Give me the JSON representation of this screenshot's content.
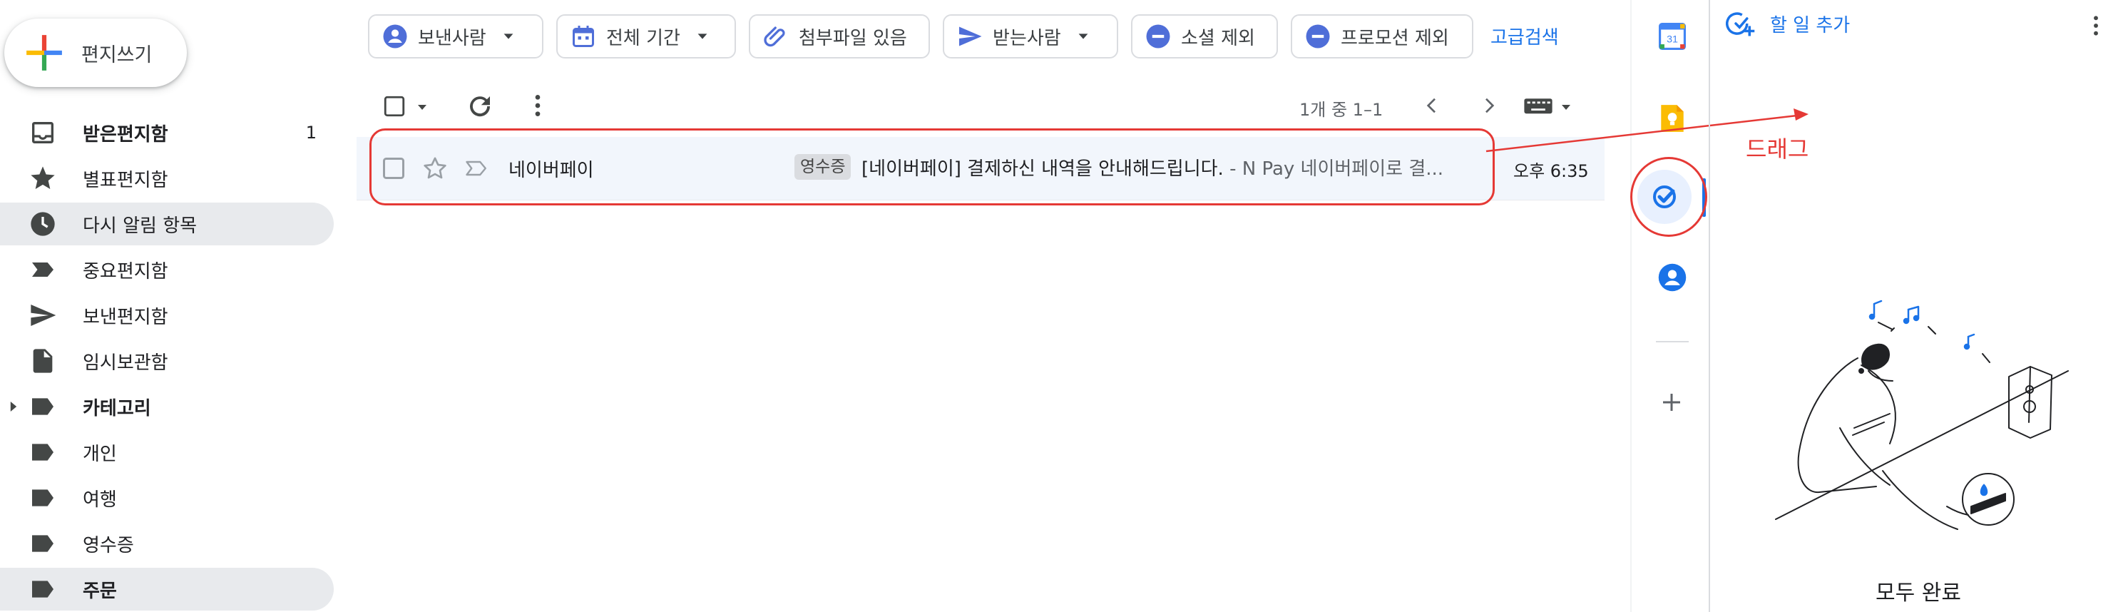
{
  "compose": {
    "label": "편지쓰기"
  },
  "sidebar": {
    "items": [
      {
        "label": "받은편지함",
        "count": "1",
        "icon": "inbox-icon"
      },
      {
        "label": "별표편지함",
        "icon": "star-icon"
      },
      {
        "label": "다시 알림 항목",
        "icon": "clock-icon"
      },
      {
        "label": "중요편지함",
        "icon": "important-icon"
      },
      {
        "label": "보낸편지함",
        "icon": "send-icon"
      },
      {
        "label": "임시보관함",
        "icon": "draft-icon"
      },
      {
        "label": "카테고리",
        "icon": "label-icon"
      },
      {
        "label": "개인",
        "icon": "label-icon"
      },
      {
        "label": "여행",
        "icon": "label-icon"
      },
      {
        "label": "영수증",
        "icon": "label-icon"
      },
      {
        "label": "주문",
        "icon": "label-icon"
      }
    ]
  },
  "search_chips": {
    "sender": "보낸사람",
    "date": "전체 기간",
    "attachment": "첨부파일 있음",
    "recipient": "받는사람",
    "exclude_social": "소셜 제외",
    "exclude_promotions": "프로모션 제외",
    "advanced": "고급검색"
  },
  "toolbar": {
    "pagination": "1개 중 1–1"
  },
  "mail": {
    "sender": "네이버페이",
    "label": "영수증",
    "subject": "[네이버페이] 결제하신 내역을 안내해드립니다.",
    "snippet": " - N Pay 네이버페이로 결...",
    "time": "오후 6:35"
  },
  "rail": {
    "calendar_day": "31"
  },
  "annotation": {
    "drag_label": "드래그",
    "color": "#e53935"
  },
  "tasks": {
    "add_task": "할 일 추가",
    "empty_state": "모두 완료"
  },
  "colors": {
    "accent": "#1a73e8",
    "selected_bg": "#e8eaed",
    "row_bg": "#f2f6fc"
  }
}
